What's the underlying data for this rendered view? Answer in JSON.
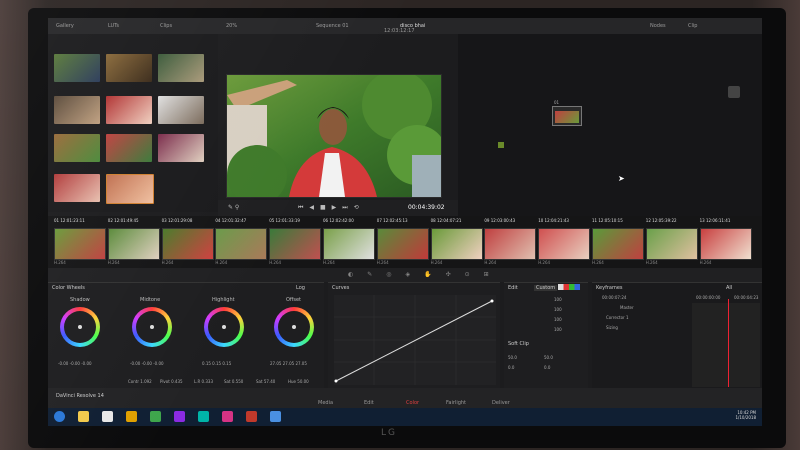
{
  "topbar": {
    "left_items": [
      "Gallery",
      "LUTs",
      "Clips"
    ],
    "project_name": "disco bhai",
    "sequence_label": "Sequence 01",
    "timecode": "12:03:12:17",
    "zoom": "20%",
    "right_items": [
      "Nodes",
      "Clip"
    ]
  },
  "viewer": {
    "timecode": "00:04:39:02"
  },
  "node": {
    "number": "01"
  },
  "timeline": {
    "clips": [
      {
        "num": "01",
        "tc": "12:01:23:11"
      },
      {
        "num": "02",
        "tc": "12:01:49:45"
      },
      {
        "num": "03",
        "tc": "12:01:29:08"
      },
      {
        "num": "04",
        "tc": "12:01:32:47"
      },
      {
        "num": "05",
        "tc": "12:01:33:19"
      },
      {
        "num": "06",
        "tc": "12:02:42:00"
      },
      {
        "num": "07",
        "tc": "12:02:45:13"
      },
      {
        "num": "08",
        "tc": "12:04:07:21"
      },
      {
        "num": "09",
        "tc": "12:03:00:43"
      },
      {
        "num": "10",
        "tc": "12:04:21:43"
      },
      {
        "num": "11",
        "tc": "12:05:10:15"
      },
      {
        "num": "12",
        "tc": "12:05:39:22"
      },
      {
        "num": "13",
        "tc": "12:06:11:41"
      }
    ],
    "codec": "H.264"
  },
  "color_wheels": {
    "title": "Color Wheels",
    "mode": "Log",
    "wheels": [
      {
        "label": "Shadow",
        "values": "-0.00  -0.00  -0.00"
      },
      {
        "label": "Midtone",
        "values": "-0.00  -0.00  -0.00"
      },
      {
        "label": "Highlight",
        "values": "0.15  0.15  0.15"
      },
      {
        "label": "Offset",
        "values": "27.05  27.05  27.05"
      }
    ],
    "footer": [
      "Contr  1.092",
      "Pivot  0.435",
      "L.R  0.333",
      "Sat  0.550",
      "Sat  57.40",
      "Hue  50.00"
    ]
  },
  "curves": {
    "title": "Curves"
  },
  "custom": {
    "title": "Edit",
    "mode": "Custom",
    "values": [
      "100",
      "100",
      "100",
      "100"
    ],
    "soft_clip": "Soft Clip",
    "low": "50.0",
    "high": "50.0",
    "ls": "0.0",
    "hs": "0.0"
  },
  "keyframes": {
    "title": "Keyframes",
    "mode": "All",
    "timecode": "00:00:07:24",
    "master": "Master",
    "tracks": [
      "Corrector 1",
      "Sizing"
    ],
    "ruler_a": "00:00:00:00",
    "ruler_b": "00:00:04:23"
  },
  "pages": {
    "app_name": "DaVinci Resolve 14",
    "tabs": [
      "Media",
      "Edit",
      "Color",
      "Fairlight",
      "Deliver"
    ],
    "active": "Color"
  },
  "taskbar": {
    "time": "10:42 PM",
    "date": "1/10/2018",
    "colors": [
      "#2b78d8",
      "#f2c94c",
      "#e8e8e8",
      "#e0a000",
      "#3ea64c",
      "#8a2be2",
      "#00b4a8",
      "#d63384",
      "#c0392b",
      "#4a90e2"
    ]
  }
}
